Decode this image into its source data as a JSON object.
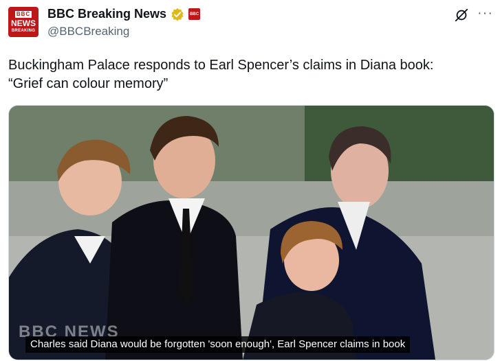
{
  "account": {
    "avatar_lines": [
      "BBC",
      "NEWS",
      "BREAKING"
    ],
    "display_name": "BBC Breaking News",
    "handle": "@BBCBreaking",
    "affiliate_badge": "BBC"
  },
  "tweet": {
    "text": "Buckingham Palace responds to Earl Spencer’s claims in Diana book:\n“Grief can colour memory”"
  },
  "media": {
    "caption": "Charles said Diana would be forgotten 'soon enough', Earl Spencer claims in book",
    "watermark": "BBC NEWS"
  },
  "icons": {
    "verified": "verified-badge-icon",
    "grok": "grok-icon",
    "more": "more-options-icon"
  },
  "colors": {
    "brand": "#bb1919",
    "verified_gold": "#e2b719",
    "secondary_text": "#536471"
  }
}
